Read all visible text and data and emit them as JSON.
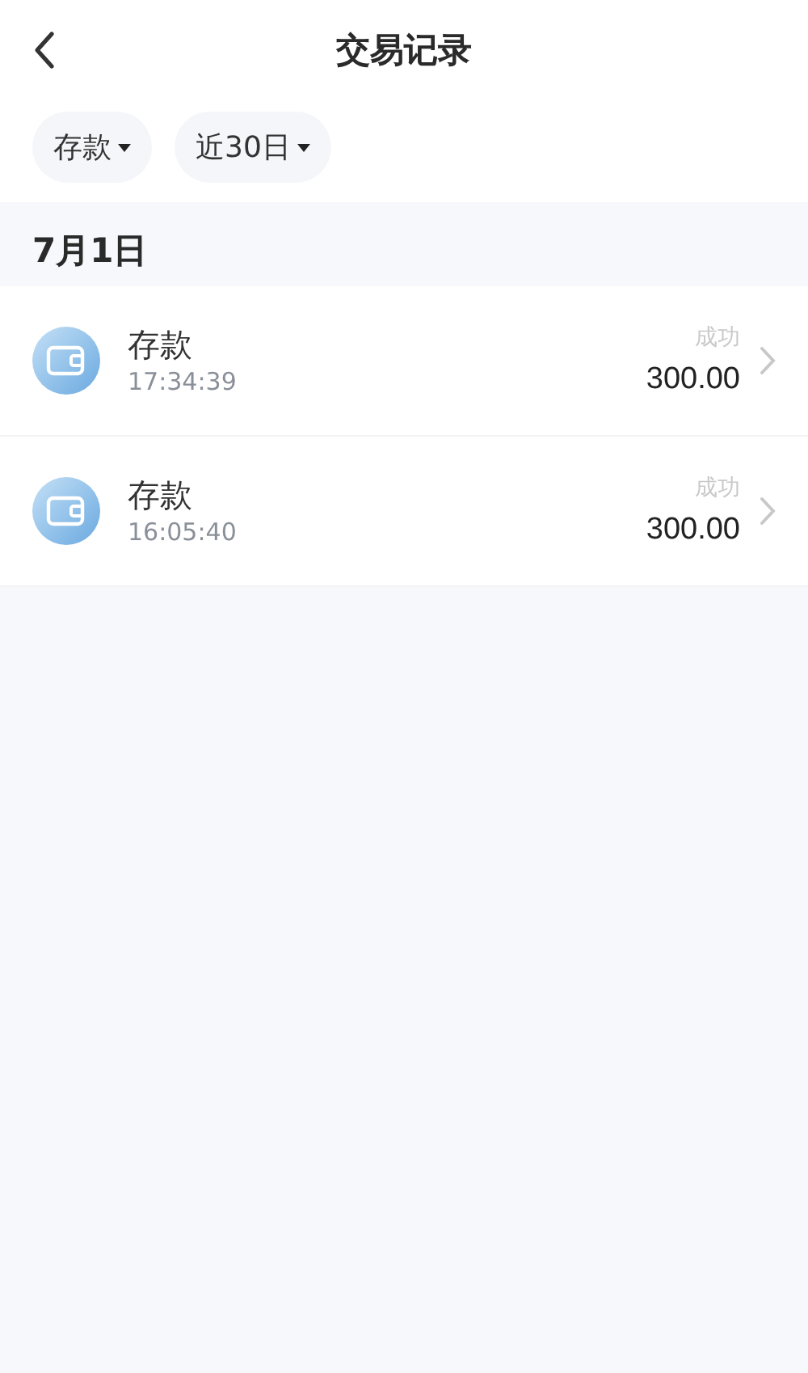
{
  "header": {
    "title": "交易记录"
  },
  "filters": [
    {
      "label": "存款"
    },
    {
      "label": "近30日"
    }
  ],
  "groups": [
    {
      "date": "7月1日",
      "records": [
        {
          "name": "存款",
          "time": "17:34:39",
          "status": "成功",
          "amount": "300.00"
        },
        {
          "name": "存款",
          "time": "16:05:40",
          "status": "成功",
          "amount": "300.00"
        }
      ]
    }
  ]
}
